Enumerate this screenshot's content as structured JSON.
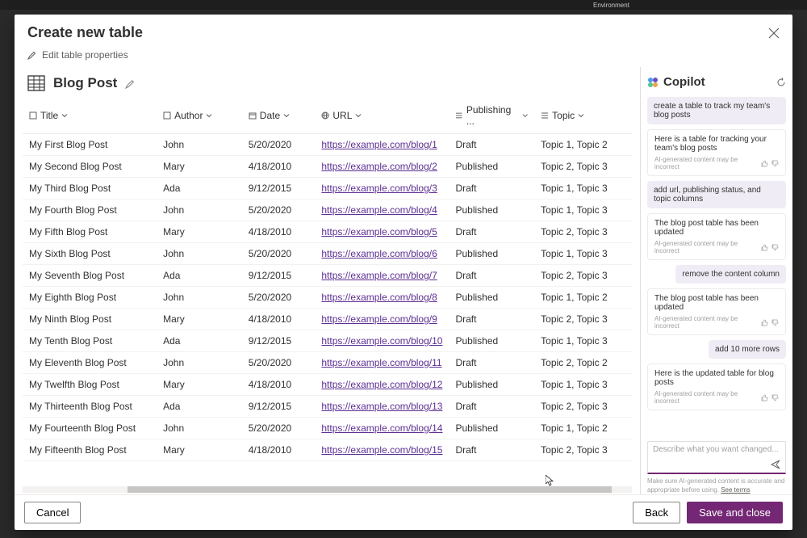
{
  "topbar": {
    "environment": "Environment"
  },
  "modal": {
    "title": "Create new table",
    "edit_props": "Edit table properties",
    "table_name": "Blog Post"
  },
  "columns": {
    "title": "Title",
    "author": "Author",
    "date": "Date",
    "url": "URL",
    "publishing": "Publishing ...",
    "topic": "Topic"
  },
  "rows": [
    {
      "title": "My First Blog Post",
      "author": "John",
      "date": "5/20/2020",
      "url": "https://example.com/blog/1",
      "pub": "Draft",
      "topic": "Topic 1, Topic 2"
    },
    {
      "title": "My Second Blog Post",
      "author": "Mary",
      "date": "4/18/2010",
      "url": "https://example.com/blog/2",
      "pub": "Published",
      "topic": "Topic 2, Topic 3"
    },
    {
      "title": "My Third Blog Post",
      "author": "Ada",
      "date": "9/12/2015",
      "url": "https://example.com/blog/3",
      "pub": "Draft",
      "topic": "Topic 1, Topic 3"
    },
    {
      "title": "My Fourth Blog Post",
      "author": "John",
      "date": "5/20/2020",
      "url": "https://example.com/blog/4",
      "pub": "Published",
      "topic": "Topic 1, Topic 3"
    },
    {
      "title": "My Fifth Blog Post",
      "author": "Mary",
      "date": "4/18/2010",
      "url": "https://example.com/blog/5",
      "pub": "Draft",
      "topic": "Topic 2, Topic 3"
    },
    {
      "title": "My Sixth Blog Post",
      "author": "John",
      "date": "5/20/2020",
      "url": "https://example.com/blog/6",
      "pub": "Published",
      "topic": "Topic 1, Topic 3"
    },
    {
      "title": "My Seventh Blog Post",
      "author": "Ada",
      "date": "9/12/2015",
      "url": "https://example.com/blog/7",
      "pub": "Draft",
      "topic": "Topic 2, Topic 3"
    },
    {
      "title": "My Eighth Blog Post",
      "author": "John",
      "date": "5/20/2020",
      "url": "https://example.com/blog/8",
      "pub": "Published",
      "topic": "Topic 1, Topic 2"
    },
    {
      "title": "My Ninth Blog Post",
      "author": "Mary",
      "date": "4/18/2010",
      "url": "https://example.com/blog/9",
      "pub": "Draft",
      "topic": "Topic 2, Topic 3"
    },
    {
      "title": "My Tenth Blog Post",
      "author": "Ada",
      "date": "9/12/2015",
      "url": "https://example.com/blog/10",
      "pub": "Published",
      "topic": "Topic 1, Topic 3"
    },
    {
      "title": "My Eleventh Blog Post",
      "author": "John",
      "date": "5/20/2020",
      "url": "https://example.com/blog/11",
      "pub": "Draft",
      "topic": "Topic 2, Topic 2"
    },
    {
      "title": "My Twelfth Blog Post",
      "author": "Mary",
      "date": "4/18/2010",
      "url": "https://example.com/blog/12",
      "pub": "Published",
      "topic": "Topic 1, Topic 3"
    },
    {
      "title": "My Thirteenth Blog Post",
      "author": "Ada",
      "date": "9/12/2015",
      "url": "https://example.com/blog/13",
      "pub": "Draft",
      "topic": "Topic 2, Topic 3"
    },
    {
      "title": "My Fourteenth Blog Post",
      "author": "John",
      "date": "5/20/2020",
      "url": "https://example.com/blog/14",
      "pub": "Published",
      "topic": "Topic 1, Topic 2"
    },
    {
      "title": "My Fifteenth Blog Post",
      "author": "Mary",
      "date": "4/18/2010",
      "url": "https://example.com/blog/15",
      "pub": "Draft",
      "topic": "Topic 2, Topic 3"
    }
  ],
  "copilot": {
    "name": "Copilot",
    "chat": [
      {
        "role": "user",
        "text": "create a table to track my team's blog posts"
      },
      {
        "role": "ai",
        "text": "Here is a table for tracking your team's blog posts"
      },
      {
        "role": "user",
        "text": "add url, publishing status, and topic columns"
      },
      {
        "role": "ai",
        "text": "The blog post table has been updated"
      },
      {
        "role": "user",
        "text": "remove the content column"
      },
      {
        "role": "ai",
        "text": "The blog post table has been updated"
      },
      {
        "role": "user",
        "text": "add 10 more rows"
      },
      {
        "role": "ai",
        "text": "Here is the updated table for blog posts"
      }
    ],
    "disclaimer": "AI-generated content may be incorrect",
    "input_placeholder": "Describe what you want changed...",
    "footer": "Make sure AI-generated content is accurate and appropriate before using.",
    "footer_link": "See terms"
  },
  "buttons": {
    "cancel": "Cancel",
    "back": "Back",
    "save": "Save and close"
  }
}
